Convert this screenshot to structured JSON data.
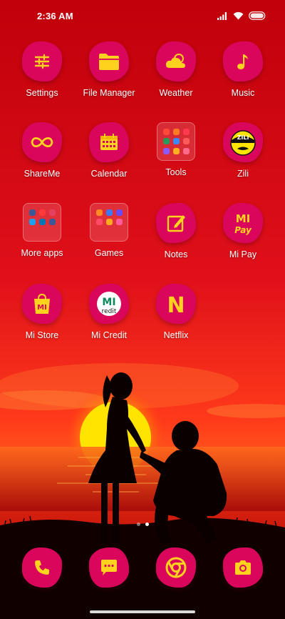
{
  "status_bar": {
    "time": "2:36 AM",
    "icons": [
      "signal-icon",
      "wifi-icon",
      "battery-icon"
    ]
  },
  "apps": [
    {
      "name": "Settings",
      "icon": "sliders-icon"
    },
    {
      "name": "File Manager",
      "icon": "folder-icon"
    },
    {
      "name": "Weather",
      "icon": "cloud-sun-icon"
    },
    {
      "name": "Music",
      "icon": "music-note-icon"
    },
    {
      "name": "ShareMe",
      "icon": "infinity-icon"
    },
    {
      "name": "Calendar",
      "icon": "calendar-icon"
    },
    {
      "name": "Tools",
      "icon": "folder-preview-icon"
    },
    {
      "name": "Zili",
      "icon": "zili-face-icon"
    },
    {
      "name": "More apps",
      "icon": "folder-preview-icon"
    },
    {
      "name": "Games",
      "icon": "folder-preview-icon"
    },
    {
      "name": "Notes",
      "icon": "note-pencil-icon"
    },
    {
      "name": "Mi Pay",
      "icon": "mi-pay-icon"
    },
    {
      "name": "Mi Store",
      "icon": "shopping-bag-icon"
    },
    {
      "name": "Mi Credit",
      "icon": "mi-credit-icon"
    },
    {
      "name": "Netflix",
      "icon": "netflix-icon"
    }
  ],
  "icon_text": {
    "mi_pay_top": "MI",
    "mi_pay_bottom": "Pay",
    "mi_store": "MI",
    "mi_credit_top": "MI",
    "mi_credit_bottom": "redit",
    "netflix": "N",
    "zili": "ZILI"
  },
  "dock": [
    {
      "name": "Phone",
      "icon": "phone-icon"
    },
    {
      "name": "Messages",
      "icon": "message-icon"
    },
    {
      "name": "Chrome",
      "icon": "chrome-icon"
    },
    {
      "name": "Camera",
      "icon": "camera-icon"
    }
  ],
  "page_indicator": {
    "pages": 2,
    "current": 2
  },
  "colors": {
    "icon_bg": "#d9065c",
    "icon_glyph": "#ffd21e",
    "wallpaper_top": "#c4000c",
    "wallpaper_sun": "#ffe600"
  }
}
